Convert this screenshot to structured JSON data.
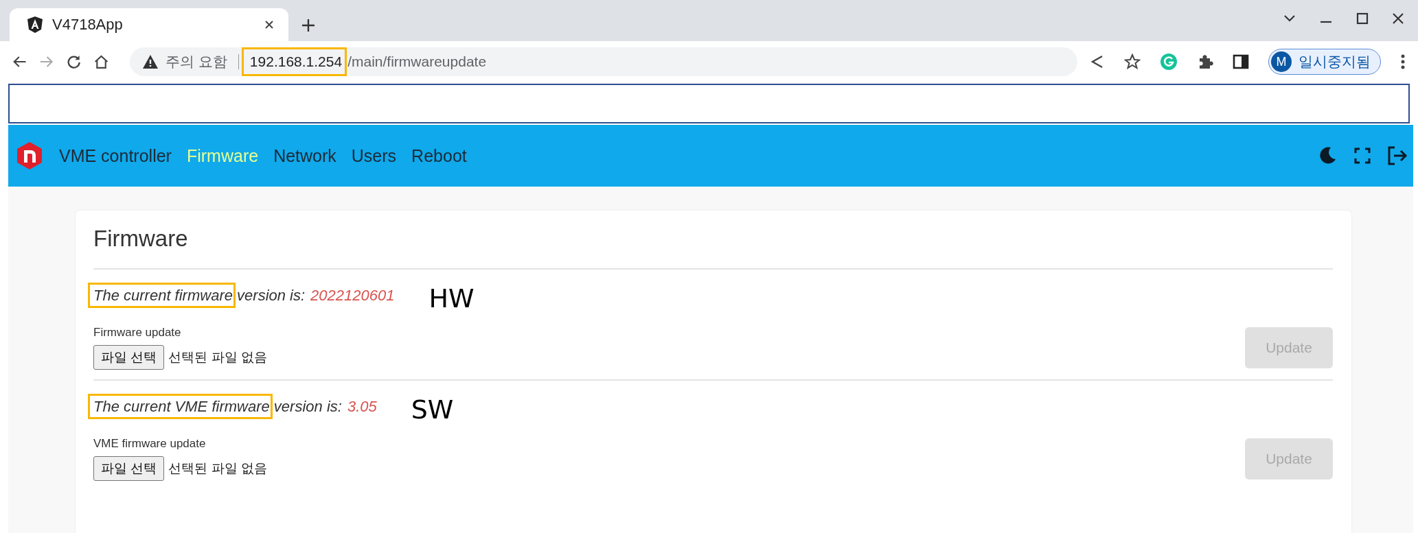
{
  "browser": {
    "tabs": [
      {
        "title": "V4718App",
        "selected": true
      }
    ],
    "omnibox": {
      "security_label": "주의 요함",
      "host": "192.168.1.254",
      "path": "/main/firmwareupdate",
      "highlighted": true
    },
    "profile": {
      "initial": "M",
      "status": "일시중지됨"
    }
  },
  "navbar": {
    "items": [
      {
        "label": "VME controller",
        "selected": false
      },
      {
        "label": "Firmware",
        "selected": true
      },
      {
        "label": "Network",
        "selected": false
      },
      {
        "label": "Users",
        "selected": false
      },
      {
        "label": "Reboot",
        "selected": false
      }
    ]
  },
  "card": {
    "title": "Firmware",
    "sections": [
      {
        "label_start": "The current firmware",
        "label_end": "version is:",
        "highlighted": true,
        "value": "2022120601",
        "annotation": "HW",
        "update_label": "Firmware update",
        "file_button": "파일 선택",
        "file_status": "선택된 파일 없음",
        "update_button": {
          "label": "Update",
          "disabled": true
        }
      },
      {
        "label_start": "The current VME firmware",
        "label_end": "version is:",
        "highlighted": true,
        "value": "3.05",
        "annotation": "SW",
        "update_label": "VME firmware update",
        "file_button": "파일 선택",
        "file_status": "선택된 파일 없음",
        "update_button": {
          "label": "Update",
          "disabled": true
        }
      }
    ]
  }
}
